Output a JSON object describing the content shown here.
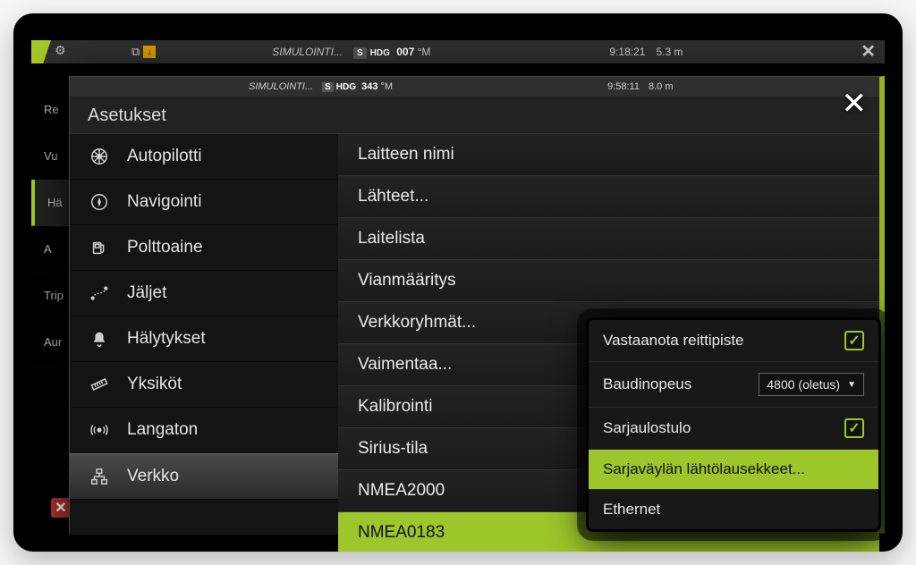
{
  "back": {
    "sim": "SIMULOINTI...",
    "hdg_label": "S",
    "hdg_label2": "HDG",
    "hdg_value": "007",
    "hdg_unit": "°M",
    "time": "9:18:21",
    "depth": "5.3 m",
    "side_items": [
      "Re",
      "Vu",
      "Hä",
      "A",
      "Trip",
      "Aur"
    ]
  },
  "front": {
    "top": {
      "sim": "SIMULOINTI...",
      "hdg_label": "S",
      "hdg_label2": "HDG",
      "hdg_value": "343",
      "hdg_unit": "°M",
      "time": "9:58:11",
      "depth": "8.0 m"
    },
    "title": "Asetukset",
    "nav": [
      {
        "icon": "wheel",
        "label": "Autopilotti"
      },
      {
        "icon": "compass",
        "label": "Navigointi"
      },
      {
        "icon": "fuel",
        "label": "Polttoaine"
      },
      {
        "icon": "track",
        "label": "Jäljet"
      },
      {
        "icon": "bell",
        "label": "Hälytykset"
      },
      {
        "icon": "ruler",
        "label": "Yksiköt"
      },
      {
        "icon": "wireless",
        "label": "Langaton"
      },
      {
        "icon": "network",
        "label": "Verkko"
      }
    ],
    "selected_nav": 7,
    "list": [
      "Laitteen nimi",
      "Lähteet...",
      "Laitelista",
      "Vianmääritys",
      "Verkkoryhmät...",
      "Vaimentaa...",
      "Kalibrointi",
      "Sirius-tila",
      "NMEA2000",
      "NMEA0183"
    ],
    "selected_list": 9
  },
  "popup": {
    "rows": [
      {
        "label": "Vastaanota reittipiste",
        "type": "check",
        "checked": true
      },
      {
        "label": "Baudinopeus",
        "type": "select",
        "value": "4800 (oletus)"
      },
      {
        "label": "Sarjaulostulo",
        "type": "check",
        "checked": true
      },
      {
        "label": "Sarjaväylän lähtölausekkeet...",
        "type": "highlight"
      },
      {
        "label": "Ethernet",
        "type": "plain"
      }
    ]
  }
}
